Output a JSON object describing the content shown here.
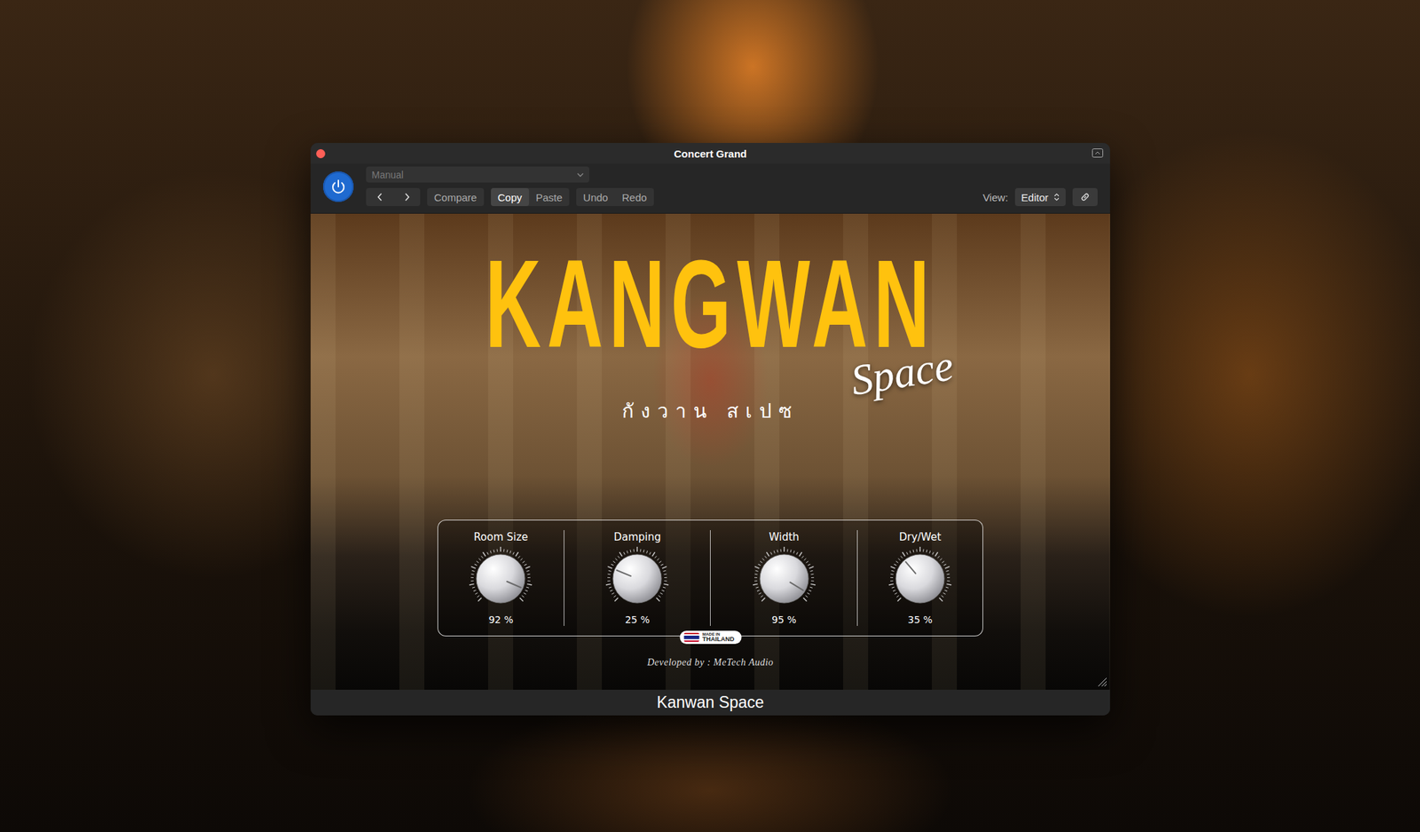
{
  "window": {
    "title": "Concert Grand",
    "footer": "Kanwan Space"
  },
  "header": {
    "power": {
      "on": true
    },
    "preset": {
      "value": "Manual",
      "disabled": true
    },
    "button_groups": [
      [
        {
          "label": "Compare",
          "selected": false
        }
      ],
      [
        {
          "label": "Copy",
          "selected": true
        },
        {
          "label": "Paste",
          "selected": false
        }
      ],
      [
        {
          "label": "Undo",
          "selected": false
        },
        {
          "label": "Redo",
          "selected": false
        }
      ]
    ],
    "view": {
      "label": "View:",
      "value": "Editor"
    }
  },
  "plugin": {
    "brand": "KANGWAN",
    "brand_script": "Space",
    "thai": "กังวาน สเปซ",
    "knobs": [
      {
        "label": "Room Size",
        "level": 0.92,
        "reading": "92 %"
      },
      {
        "label": "Damping",
        "level": 0.25,
        "reading": "25 %"
      },
      {
        "label": "Width",
        "level": 0.95,
        "reading": "95 %"
      },
      {
        "label": "Dry/Wet",
        "level": 0.35,
        "reading": "35 %"
      }
    ],
    "badge": {
      "top": "MADE IN",
      "bottom": "THAILAND"
    },
    "credit": "Developed by : MeTech Audio"
  }
}
